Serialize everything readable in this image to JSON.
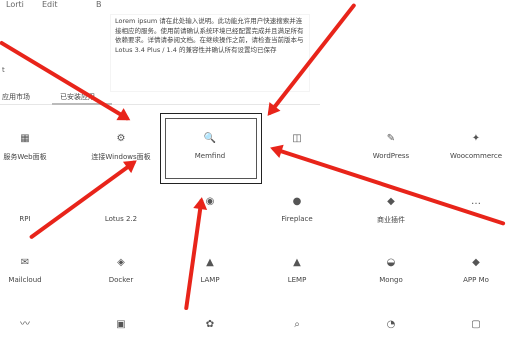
{
  "topbar": {
    "item1": "Lorti",
    "item2": "Edit",
    "item3": "B"
  },
  "tooltip": {
    "text": "Lorem ipsum 请在此处输入说明。此功能允许用户快速搜索并连接相应的服务。使用前请确认系统环境已经配置完成并且满足所有依赖要求。详情请参阅文档。在继续操作之前，请检查当前版本与 Lotus 3.4 Plus / 1.4 的兼容性并确认所有设置均已保存"
  },
  "side": {
    "label": "t"
  },
  "tabs": [
    {
      "label": "应用市场"
    },
    {
      "label": "已安装应用"
    }
  ],
  "rows": [
    [
      {
        "icon": "grid-icon",
        "glyph": "▦",
        "label": "服务Web面板"
      },
      {
        "icon": "gear-icon",
        "glyph": "⚙",
        "label": "连接Windows面板"
      },
      {
        "icon": "search-icon",
        "glyph": "🔍",
        "label": "Memfind"
      },
      {
        "icon": "window-icon",
        "glyph": "◫",
        "label": ""
      },
      {
        "icon": "wordpress-icon",
        "glyph": "✎",
        "label": "WordPress"
      },
      {
        "icon": "wordpress-alt-icon",
        "glyph": "✦",
        "label": "Woocommerce"
      }
    ],
    [
      {
        "icon": "blank-icon",
        "glyph": "",
        "label": "RPI"
      },
      {
        "icon": "blank-icon",
        "glyph": "",
        "label": "Lotus 2.2"
      },
      {
        "icon": "camera-icon",
        "glyph": "◉",
        "label": ""
      },
      {
        "icon": "ghost-icon",
        "glyph": "●",
        "label": "Fireplace"
      },
      {
        "icon": "bag-icon",
        "glyph": "◆",
        "label": "商业插件"
      },
      {
        "icon": "dots-icon",
        "glyph": "…",
        "label": ""
      }
    ],
    [
      {
        "icon": "mail-icon",
        "glyph": "✉",
        "label": "Mailcloud"
      },
      {
        "icon": "docker-icon",
        "glyph": "◈",
        "label": "Docker"
      },
      {
        "icon": "lamp-icon",
        "glyph": "▲",
        "label": "LAMP"
      },
      {
        "icon": "lemp-icon",
        "glyph": "▲",
        "label": "LEMP"
      },
      {
        "icon": "mongo-icon",
        "glyph": "◒",
        "label": "Mongo"
      },
      {
        "icon": "gem-icon",
        "glyph": "◆",
        "label": "APP Mo"
      }
    ],
    [
      {
        "icon": "wave-icon",
        "glyph": "〰",
        "label": ""
      },
      {
        "icon": "image-icon",
        "glyph": "▣",
        "label": ""
      },
      {
        "icon": "gear2-icon",
        "glyph": "✿",
        "label": ""
      },
      {
        "icon": "search2-icon",
        "glyph": "⌕",
        "label": ""
      },
      {
        "icon": "clock-icon",
        "glyph": "◔",
        "label": ""
      },
      {
        "icon": "lock-icon",
        "glyph": "▢",
        "label": ""
      }
    ]
  ],
  "colors": {
    "arrow": "#e8241a",
    "selection": "#222222"
  }
}
